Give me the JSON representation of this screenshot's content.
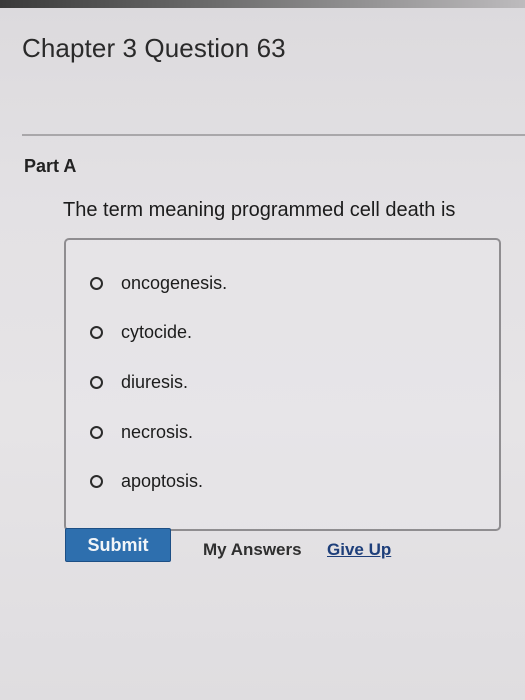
{
  "header": {
    "title": "Chapter 3 Question 63"
  },
  "part": {
    "label": "Part A"
  },
  "question": {
    "text": "The term meaning programmed cell death is"
  },
  "options": [
    {
      "label": "oncogenesis."
    },
    {
      "label": "cytocide."
    },
    {
      "label": "diuresis."
    },
    {
      "label": "necrosis."
    },
    {
      "label": "apoptosis."
    }
  ],
  "actions": {
    "submit_label": "Submit",
    "my_answers_label": "My Answers",
    "give_up_label": "Give Up"
  },
  "colors": {
    "submit_bg": "#2e6fae",
    "link": "#1e3f7a"
  }
}
